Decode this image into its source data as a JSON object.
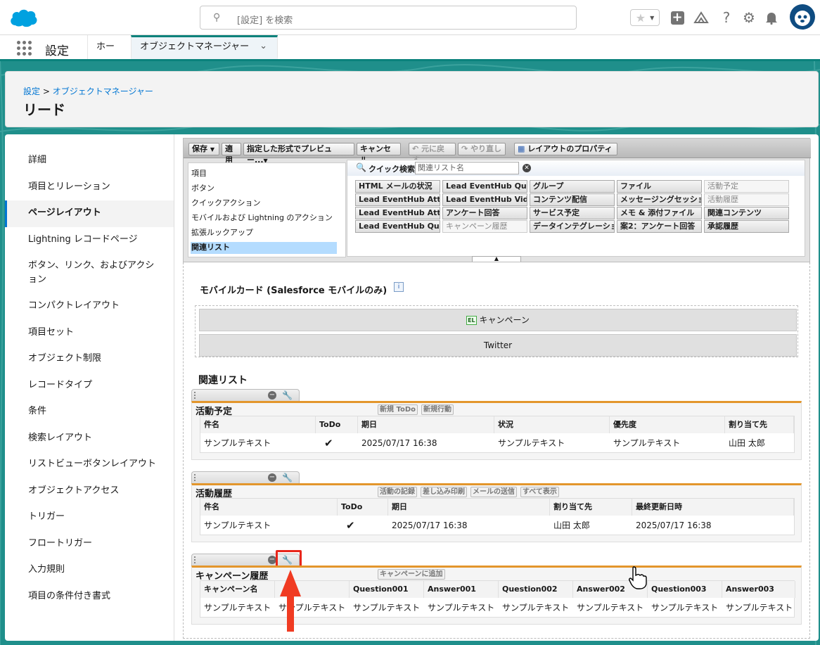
{
  "search": {
    "placeholder": "[設定] を検索"
  },
  "nav": {
    "app_name": "設定",
    "tab_home": "ホーム",
    "tab_object_manager": "オブジェクトマネージャー"
  },
  "header": {
    "breadcrumb_root": "設定",
    "breadcrumb_sep": " > ",
    "breadcrumb_current": "オブジェクトマネージャー",
    "title": "リード"
  },
  "sidebar": {
    "items": [
      "詳細",
      "項目とリレーション",
      "ページレイアウト",
      "Lightning レコードページ",
      "ボタン、リンク、およびアクション",
      "コンパクトレイアウト",
      "項目セット",
      "オブジェクト制限",
      "レコードタイプ",
      "条件",
      "検索レイアウト",
      "リストビューボタンレイアウト",
      "オブジェクトアクセス",
      "トリガー",
      "フロートリガー",
      "入力規則",
      "項目の条件付き書式"
    ],
    "selected": "ページレイアウト"
  },
  "toolbar": {
    "save": "保存",
    "apply": "適用",
    "preview": "指定した形式でプレビュー...",
    "cancel": "キャンセル",
    "undo": "元に戻す",
    "redo": "やり直し",
    "layout_props": "レイアウトのプロパティ"
  },
  "palette": {
    "categories": [
      "項目",
      "ボタン",
      "クイックアクション",
      "モバイルおよび Lightning のアクション",
      "拡張ルックアップ",
      "関連リスト"
    ],
    "selected_category": "関連リスト",
    "quick_find_label": "クイック検索",
    "quick_find_placeholder": "関連リスト名",
    "items": [
      [
        "HTML メールの状況",
        "Lead EventHub Att...",
        "Lead EventHub Att...",
        "Lead EventHub Que..."
      ],
      [
        "Lead EventHub Que...",
        "Lead EventHub Vid...",
        "アンケート回答",
        "キャンペーン履歴"
      ],
      [
        "グループ",
        "コンテンツ配信",
        "サービス予定",
        "データインテグレーション"
      ],
      [
        "ファイル",
        "メッセージングセッション",
        "メモ & 添付ファイル",
        "案2：アンケート回答"
      ],
      [
        "活動予定",
        "活動履歴",
        "関連コンテンツ",
        "承認履歴"
      ]
    ]
  },
  "mobile_cards": {
    "title": "モバイルカード (Salesforce モバイルのみ)",
    "campaign": "キャンペーン",
    "twitter": "Twitter"
  },
  "related_lists_title": "関連リスト",
  "rl_activities": {
    "title": "活動予定",
    "buttons": [
      "新規 ToDo",
      "新規行動"
    ],
    "columns": [
      "件名",
      "ToDo",
      "期日",
      "状況",
      "優先度",
      "割り当て先"
    ],
    "row": [
      "サンプルテキスト",
      "✔",
      "2025/07/17 16:38",
      "サンプルテキスト",
      "サンプルテキスト",
      "山田 太郎"
    ]
  },
  "rl_history": {
    "title": "活動履歴",
    "buttons": [
      "活動の記録",
      "差し込み印刷",
      "メールの送信",
      "すべて表示"
    ],
    "columns": [
      "件名",
      "ToDo",
      "期日",
      "割り当て先",
      "最終更新日時"
    ],
    "row": [
      "サンプルテキスト",
      "✔",
      "2025/07/17 16:38",
      "山田 太郎",
      "2025/07/17 16:38"
    ]
  },
  "rl_campaign": {
    "title": "キャンペーン履歴",
    "buttons": [
      "キャンペーンに追加"
    ],
    "columns": [
      "キャンペーン名",
      "",
      "Question001",
      "Answer001",
      "Question002",
      "Answer002",
      "Question003",
      "Answer003"
    ],
    "row": [
      "サンプルテキスト",
      "サンプルテキスト",
      "サンプルテキスト",
      "サンプルテキスト",
      "サンプルテキスト",
      "サンプルテキスト",
      "サンプルテキスト",
      "サンプルテキスト"
    ]
  },
  "colors": {
    "brand": "#00a1e0",
    "teal": "#1f8f8b",
    "accent": "#0176d3",
    "rl_border": "#e3962c",
    "highlight": "#e8261b"
  }
}
